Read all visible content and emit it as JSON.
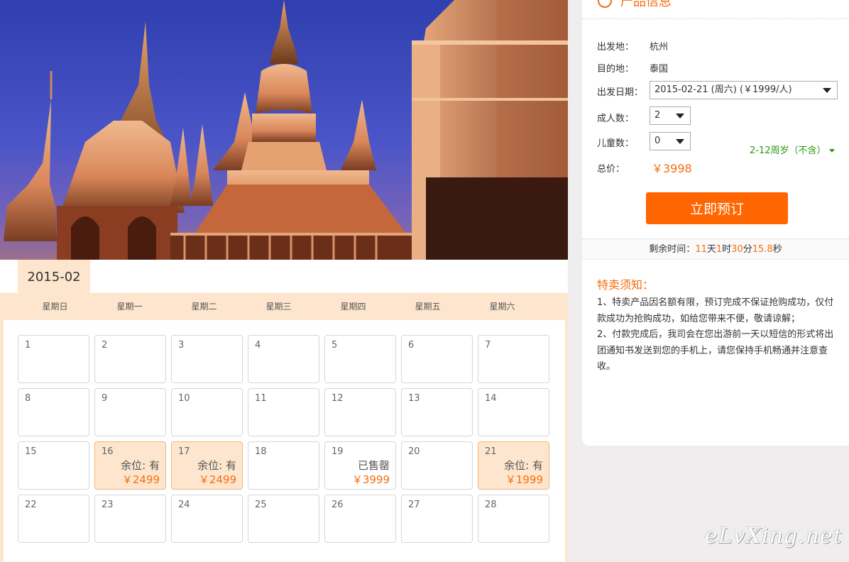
{
  "calendar": {
    "month": "2015-02",
    "weekdays": [
      "星期日",
      "星期一",
      "星期二",
      "星期三",
      "星期四",
      "星期五",
      "星期六"
    ],
    "days": [
      {
        "d": "1"
      },
      {
        "d": "2"
      },
      {
        "d": "3"
      },
      {
        "d": "4"
      },
      {
        "d": "5"
      },
      {
        "d": "6"
      },
      {
        "d": "7"
      },
      {
        "d": "8"
      },
      {
        "d": "9"
      },
      {
        "d": "10"
      },
      {
        "d": "11"
      },
      {
        "d": "12"
      },
      {
        "d": "13"
      },
      {
        "d": "14"
      },
      {
        "d": "15"
      },
      {
        "d": "16",
        "status": "余位: 有",
        "price": "￥2499",
        "avail": true
      },
      {
        "d": "17",
        "status": "余位: 有",
        "price": "￥2499",
        "avail": true
      },
      {
        "d": "18"
      },
      {
        "d": "19",
        "status": "已售罄",
        "price": "￥3999",
        "avail": false
      },
      {
        "d": "20"
      },
      {
        "d": "21",
        "status": "余位: 有",
        "price": "￥1999",
        "avail": true
      },
      {
        "d": "22"
      },
      {
        "d": "23"
      },
      {
        "d": "24"
      },
      {
        "d": "25"
      },
      {
        "d": "26"
      },
      {
        "d": "27"
      },
      {
        "d": "28"
      }
    ]
  },
  "product": {
    "title": "产品信息",
    "departure_label": "出发地：",
    "departure": "杭州",
    "destination_label": "目的地：",
    "destination": "泰国",
    "date_label": "出发日期：",
    "date_value": "2015-02-21 (周六) (￥1999/人)",
    "adults_label": "成人数：",
    "adults_value": "2",
    "children_label": "儿童数：",
    "children_value": "0",
    "child_age_tip": "2-12周岁（不含）",
    "total_label": "总价：",
    "total_value": "￥3998",
    "book_button": "立即预订",
    "countdown": {
      "label": "剩余时间：",
      "days": "11",
      "days_unit": "天",
      "hours": "1",
      "hours_unit": "时",
      "minutes": "30",
      "minutes_unit": "分",
      "seconds": "15.8",
      "seconds_unit": "秒"
    },
    "notice_title": "特卖须知：",
    "notice_items": [
      "1、特卖产品因名额有限，预订完成不保证抢购成功，仅付款成功为抢购成功，如给您带来不便，敬请谅解；",
      "2、付款完成后，我司会在您出游前一天以短信的形式将出团通知书发送到您的手机上，请您保持手机畅通并注意查收。"
    ]
  },
  "watermark": "eLvXing.net",
  "colors": {
    "accent": "#ff6600",
    "price": "#f56d0e",
    "available_bg": "#fde6cd",
    "tip_green": "#2c9a0f"
  }
}
